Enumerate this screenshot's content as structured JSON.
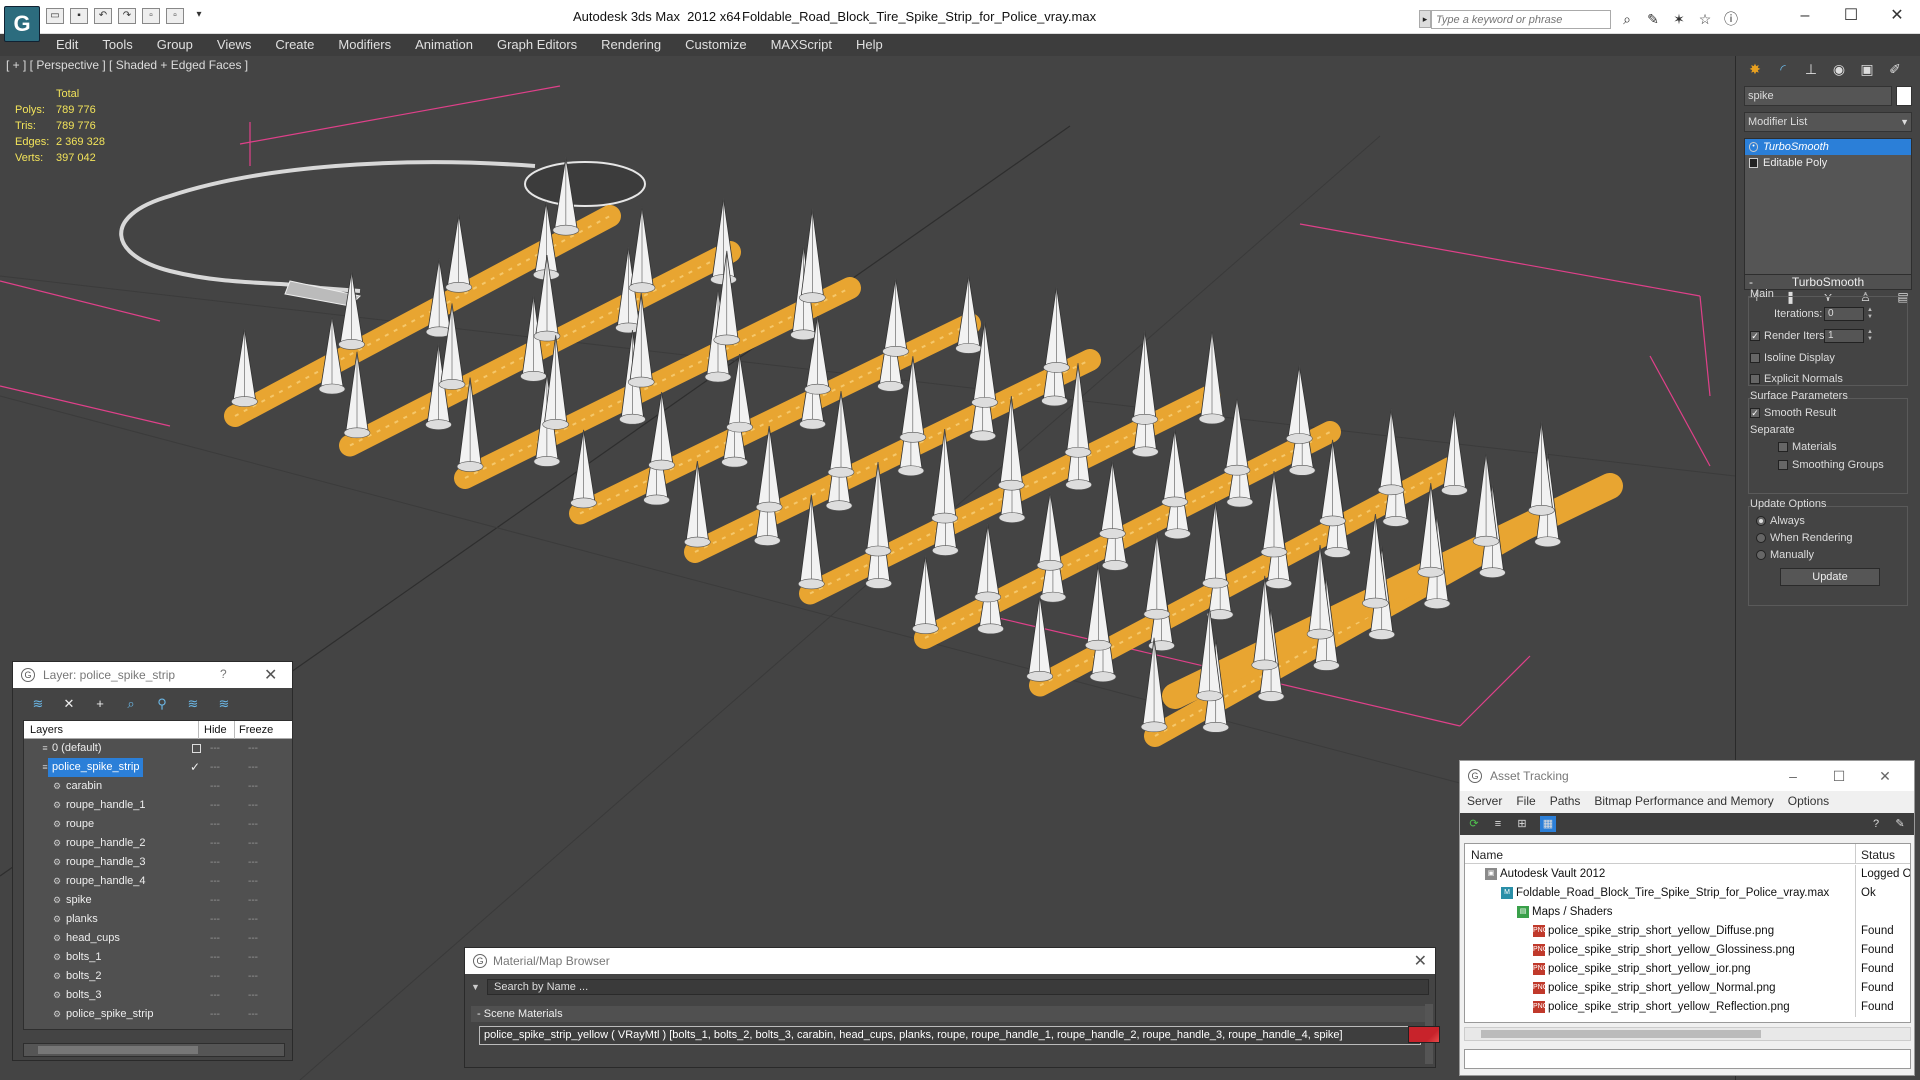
{
  "app": {
    "title": "Autodesk 3ds Max  2012 x64",
    "document": "Foldable_Road_Block_Tire_Spike_Strip_for_Police_vray.max",
    "search_placeholder": "Type a keyword or phrase",
    "logo": "3ds-max-logo"
  },
  "menu": [
    "Edit",
    "Tools",
    "Group",
    "Views",
    "Create",
    "Modifiers",
    "Animation",
    "Graph Editors",
    "Rendering",
    "Customize",
    "MAXScript",
    "Help"
  ],
  "viewport": {
    "label": "[ + ] [ Perspective ] [ Shaded + Edged Faces ]",
    "stats_header": "Total",
    "stats": [
      {
        "key": "Polys:",
        "value": "789 776"
      },
      {
        "key": "Tris:",
        "value": "789 776"
      },
      {
        "key": "Edges:",
        "value": "2 369 328"
      },
      {
        "key": "Verts:",
        "value": "397 042"
      }
    ]
  },
  "command_panel": {
    "object_name": "spike",
    "modifier_list": "Modifier List",
    "stack": [
      {
        "name": "TurboSmooth",
        "selected": true
      },
      {
        "name": "Editable Poly",
        "selected": false
      }
    ],
    "turbosmooth": {
      "title": "TurboSmooth",
      "main": "Main",
      "iterations_label": "Iterations:",
      "iterations": "0",
      "render_iters_label": "Render Iters:",
      "render_iters": "1",
      "isoline": "Isoline Display",
      "explicit_normals": "Explicit Normals",
      "surface_params": "Surface Parameters",
      "smooth_result": "Smooth Result",
      "separate": "Separate",
      "materials": "Materials",
      "smoothing_groups": "Smoothing Groups",
      "update_options": "Update Options",
      "always": "Always",
      "when_rendering": "When Rendering",
      "manually": "Manually",
      "update": "Update"
    }
  },
  "layer_window": {
    "title": "Layer: police_spike_strip",
    "help": "?",
    "columns": [
      "Layers",
      "Hide",
      "Freeze"
    ],
    "rows": [
      {
        "name": "0 (default)",
        "level": 0,
        "type": "layer"
      },
      {
        "name": "police_spike_strip",
        "level": 0,
        "type": "layer",
        "selected": true
      },
      {
        "name": "carabin",
        "level": 1,
        "type": "object"
      },
      {
        "name": "roupe_handle_1",
        "level": 1,
        "type": "object"
      },
      {
        "name": "roupe",
        "level": 1,
        "type": "object"
      },
      {
        "name": "roupe_handle_2",
        "level": 1,
        "type": "object"
      },
      {
        "name": "roupe_handle_3",
        "level": 1,
        "type": "object"
      },
      {
        "name": "roupe_handle_4",
        "level": 1,
        "type": "object"
      },
      {
        "name": "spike",
        "level": 1,
        "type": "object"
      },
      {
        "name": "planks",
        "level": 1,
        "type": "object"
      },
      {
        "name": "head_cups",
        "level": 1,
        "type": "object"
      },
      {
        "name": "bolts_1",
        "level": 1,
        "type": "object"
      },
      {
        "name": "bolts_2",
        "level": 1,
        "type": "object"
      },
      {
        "name": "bolts_3",
        "level": 1,
        "type": "object"
      },
      {
        "name": "police_spike_strip",
        "level": 1,
        "type": "object"
      }
    ]
  },
  "asset_tracking": {
    "title": "Asset Tracking",
    "menu": [
      "Server",
      "File",
      "Paths",
      "Bitmap Performance and Memory",
      "Options"
    ],
    "columns": [
      "Name",
      "Status"
    ],
    "rows": [
      {
        "name": "Autodesk Vault 2012",
        "status": "Logged O",
        "level": 0,
        "icon": "vault-icon"
      },
      {
        "name": "Foldable_Road_Block_Tire_Spike_Strip_for_Police_vray.max",
        "status": "Ok",
        "level": 1,
        "icon": "max-file-icon"
      },
      {
        "name": "Maps / Shaders",
        "status": "",
        "level": 2,
        "icon": "maps-folder-icon"
      },
      {
        "name": "police_spike_strip_short_yellow_Diffuse.png",
        "status": "Found",
        "level": 3,
        "icon": "png-icon"
      },
      {
        "name": "police_spike_strip_short_yellow_Glossiness.png",
        "status": "Found",
        "level": 3,
        "icon": "png-icon"
      },
      {
        "name": "police_spike_strip_short_yellow_ior.png",
        "status": "Found",
        "level": 3,
        "icon": "png-icon"
      },
      {
        "name": "police_spike_strip_short_yellow_Normal.png",
        "status": "Found",
        "level": 3,
        "icon": "png-icon"
      },
      {
        "name": "police_spike_strip_short_yellow_Reflection.png",
        "status": "Found",
        "level": 3,
        "icon": "png-icon"
      }
    ]
  },
  "material_browser": {
    "title": "Material/Map Browser",
    "search": "Search by Name ...",
    "group": "Scene Materials",
    "item": "police_spike_strip_yellow ( VRayMtl ) [bolts_1, bolts_2, bolts_3, carabin, head_cups, planks, roupe, roupe_handle_1, roupe_handle_2, roupe_handle_3, roupe_handle_4, spike]",
    "swatch_color": "#c8232b"
  },
  "colors": {
    "viewport_bg": "#444444",
    "plank": "#e8a531",
    "spike": "#f2f2f2",
    "selection": "#2b7fd8",
    "stats": "#f2e35a",
    "gizmo": "#e0408a"
  }
}
